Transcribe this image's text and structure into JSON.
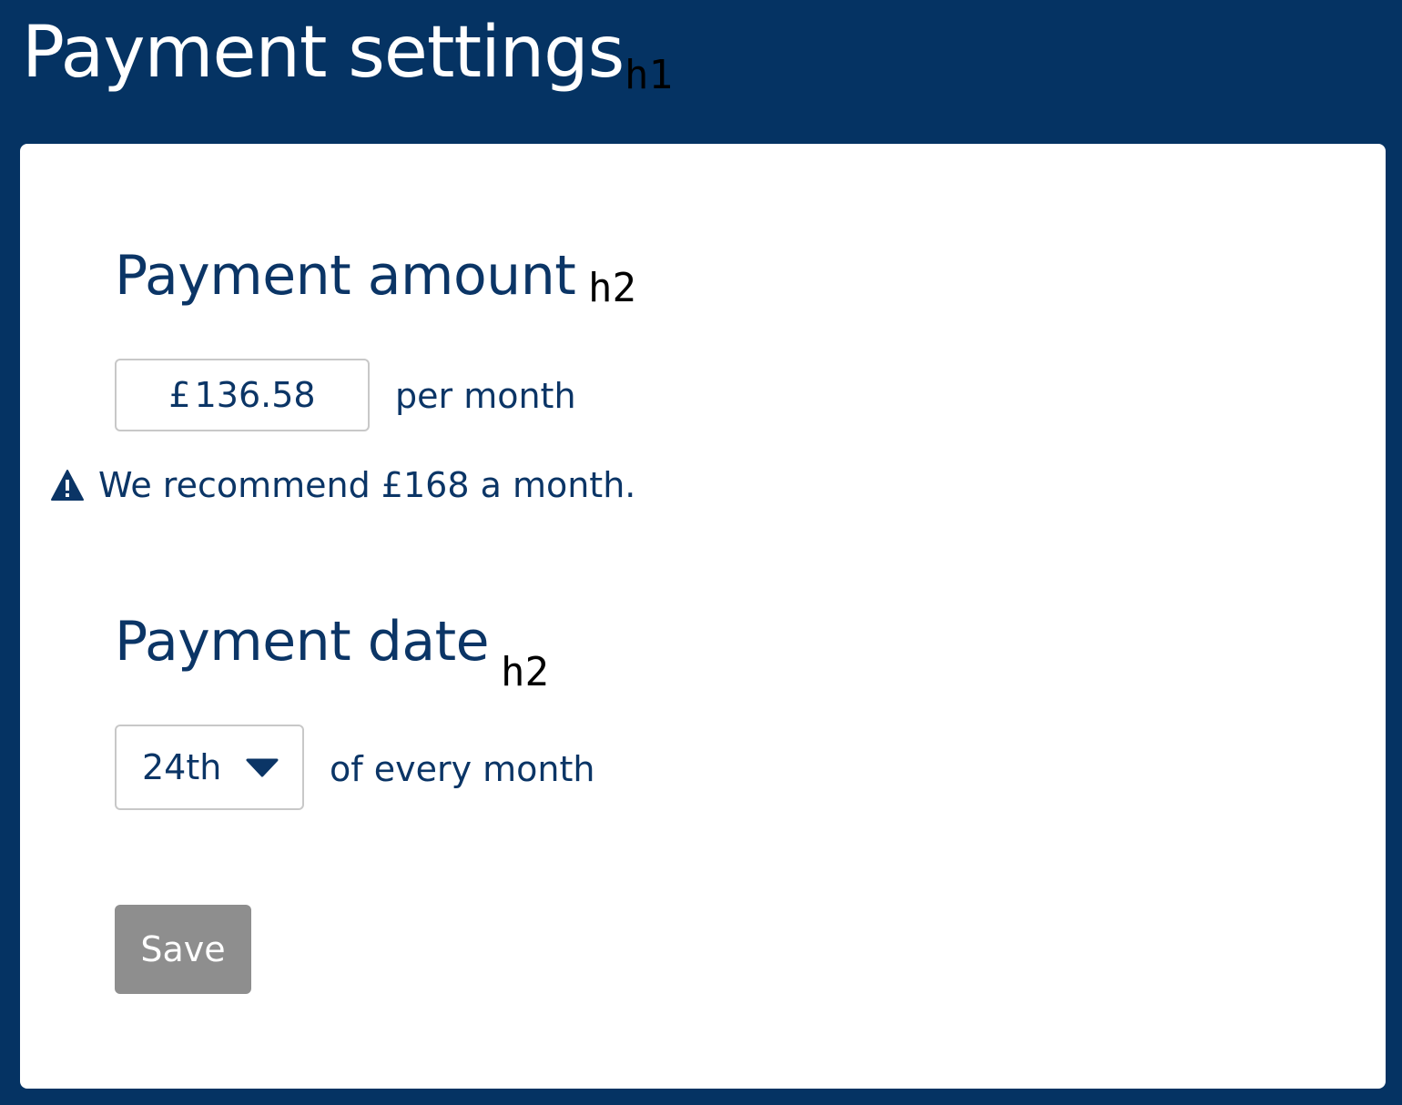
{
  "page": {
    "title": "Payment settings",
    "title_tag": "h1"
  },
  "payment_amount": {
    "heading": "Payment amount",
    "heading_tag": "h2",
    "currency_symbol": "£",
    "value": "136.58",
    "suffix": "per month",
    "warning_icon": "warning-triangle-icon",
    "warning_text": "We recommend £168 a month."
  },
  "payment_date": {
    "heading": "Payment date",
    "heading_tag": "h2",
    "selected": "24th",
    "dropdown_icon": "chevron-down-icon",
    "suffix": "of every month"
  },
  "actions": {
    "save_label": "Save",
    "save_color": "#8e8e8e"
  },
  "colors": {
    "header_background": "#053363",
    "text_primary": "#0b3566",
    "card_background": "#ffffff"
  }
}
